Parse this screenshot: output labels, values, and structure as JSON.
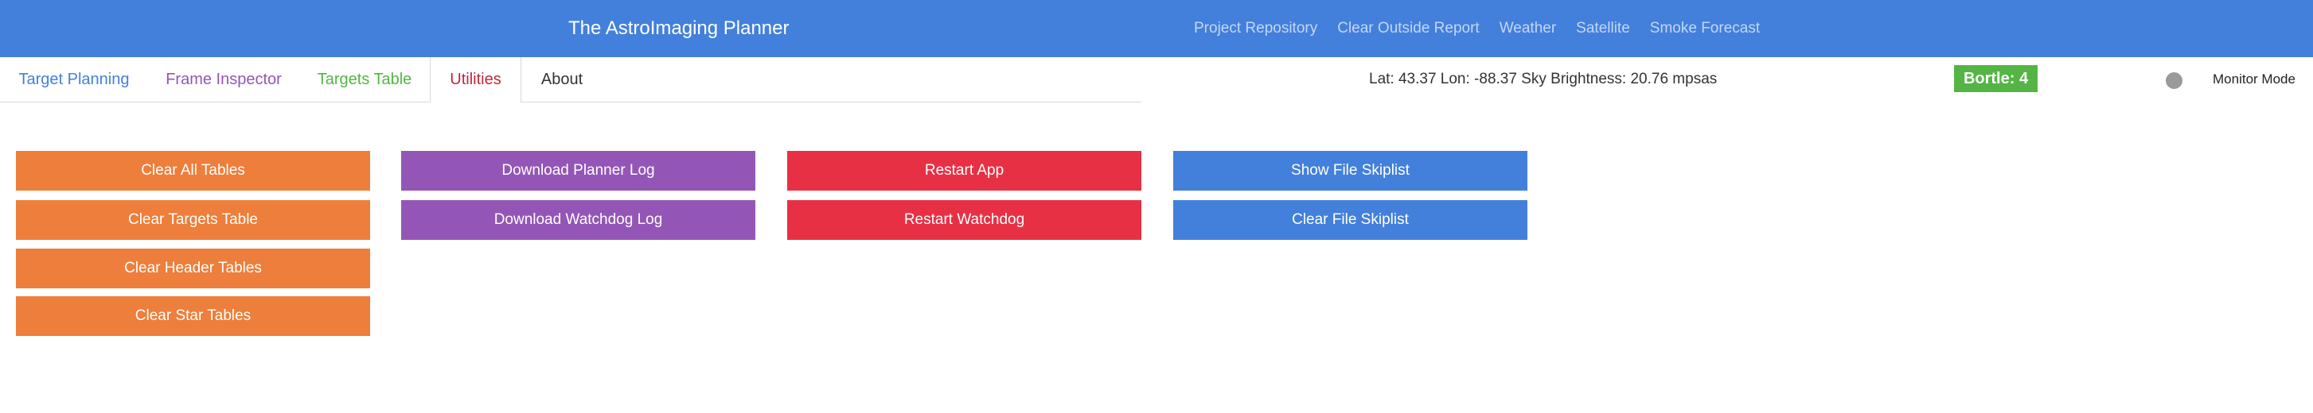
{
  "navbar": {
    "title": "The AstroImaging Planner",
    "links": [
      "Project Repository",
      "Clear Outside Report",
      "Weather",
      "Satellite",
      "Smoke Forecast"
    ]
  },
  "tabs": [
    {
      "label": "Target Planning",
      "color": "#4380db",
      "active": false
    },
    {
      "label": "Frame Inspector",
      "color": "#9356b6",
      "active": false
    },
    {
      "label": "Targets Table",
      "color": "#54b544",
      "active": false
    },
    {
      "label": "Utilities",
      "color": "#c0273a",
      "active": true
    },
    {
      "label": "About",
      "color": "#333333",
      "active": false
    }
  ],
  "status": {
    "location": "Lat: 43.37 Lon: -88.37 Sky Brightness: 20.76 mpsas",
    "bortle": "Bortle: 4",
    "monitor_mode": "Monitor Mode"
  },
  "colors": {
    "navbar": "#4380db",
    "orange": "#ee7e3b",
    "purple": "#9356b6",
    "red": "#e83044",
    "blue": "#4380db",
    "bortle": "#54b544"
  },
  "buttons": {
    "tables": [
      "Clear All Tables",
      "Clear Targets Table",
      "Clear Header Tables",
      "Clear Star Tables"
    ],
    "logs": [
      "Download Planner Log",
      "Download Watchdog Log"
    ],
    "restart": [
      "Restart App",
      "Restart Watchdog"
    ],
    "skiplist": [
      "Show File Skiplist",
      "Clear File Skiplist"
    ]
  }
}
